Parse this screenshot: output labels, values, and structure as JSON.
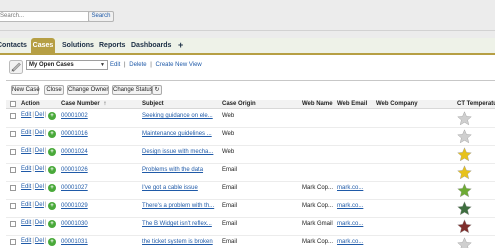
{
  "header": {
    "search_placeholder": "Search...",
    "search_button": "Search"
  },
  "tabs": [
    {
      "label": "Contacts",
      "active": false
    },
    {
      "label": "Cases",
      "active": true
    },
    {
      "label": "Solutions",
      "active": false
    },
    {
      "label": "Reports",
      "active": false
    },
    {
      "label": "Dashboards",
      "active": false
    },
    {
      "label": "+",
      "active": false
    }
  ],
  "view": {
    "selected": "My Open Cases",
    "edit_link": "Edit",
    "delete_link": "Delete",
    "create_link": "Create New View",
    "separator": "|"
  },
  "buttons": {
    "new_case": "New Case",
    "close": "Close",
    "change_owner": "Change Owner",
    "change_status": "Change Status",
    "refresh_glyph": "↻"
  },
  "columns": {
    "action": "Action",
    "case_number": "Case Number",
    "sort_indicator": "↑",
    "subject": "Subject",
    "case_origin": "Case Origin",
    "web_name": "Web Name",
    "web_email": "Web Email",
    "web_company": "Web Company",
    "ct_temperature": "CT Temperature"
  },
  "row_actions": {
    "edit": "Edit",
    "del": "Del",
    "plus": "+"
  },
  "rows": [
    {
      "case_number": "00001002",
      "subject": "Seeking guidance on ele...",
      "origin": "Web",
      "web_name": "",
      "web_email": "",
      "web_company": "",
      "temperature": "grey"
    },
    {
      "case_number": "00001016",
      "subject": "Maintenance guidelines ...",
      "origin": "Web",
      "web_name": "",
      "web_email": "",
      "web_company": "",
      "temperature": "grey"
    },
    {
      "case_number": "00001024",
      "subject": "Design issue with mecha...",
      "origin": "Web",
      "web_name": "",
      "web_email": "",
      "web_company": "",
      "temperature": "yellow"
    },
    {
      "case_number": "00001026",
      "subject": "Problems with the data",
      "origin": "Email",
      "web_name": "",
      "web_email": "",
      "web_company": "",
      "temperature": "yellow"
    },
    {
      "case_number": "00001027",
      "subject": "I've got a cable issue",
      "origin": "Email",
      "web_name": "Mark Cop...",
      "web_email": "mark.co...",
      "web_company": "",
      "temperature": "green"
    },
    {
      "case_number": "00001029",
      "subject": "There's a problem with th...",
      "origin": "Email",
      "web_name": "Mark Cop...",
      "web_email": "mark.co...",
      "web_company": "",
      "temperature": "darkgreen"
    },
    {
      "case_number": "00001030",
      "subject": "The B Widget isn't reflex...",
      "origin": "Email",
      "web_name": "Mark Gmail",
      "web_email": "mark.co...",
      "web_company": "",
      "temperature": "darkred"
    },
    {
      "case_number": "00001031",
      "subject": "the ticket system is broken",
      "origin": "Email",
      "web_name": "Mark Cop...",
      "web_email": "mark.co...",
      "web_company": "",
      "temperature": "grey"
    }
  ],
  "colors": {
    "tab_active": "#b69f44",
    "link": "#1f5aa8",
    "star_grey": "#cfcfcf",
    "star_yellow": "#e7c21c",
    "star_green": "#6dab34",
    "star_darkgreen": "#3e6e3f",
    "star_darkred": "#7f2e2c"
  }
}
